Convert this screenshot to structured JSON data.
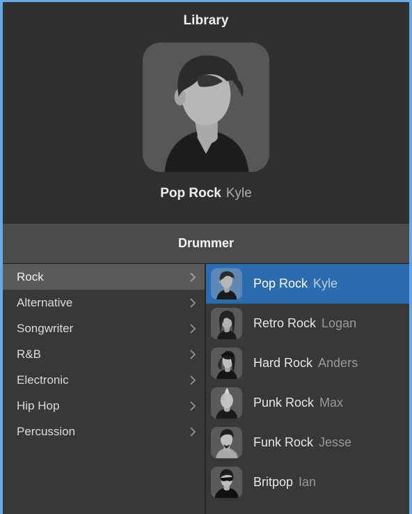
{
  "window": {
    "accent_border_color": "#68a7e8",
    "background_color": "#2e2e2e"
  },
  "library_header": {
    "title": "Library"
  },
  "preview": {
    "avatar_icon": "person-silhouette-avatar",
    "patch_name": "Pop Rock",
    "artist_name": "Kyle"
  },
  "drummer_header": {
    "title": "Drummer"
  },
  "categories": {
    "selected_index": 0,
    "chevron_icon": "chevron-right-icon",
    "items": [
      {
        "label": "Rock"
      },
      {
        "label": "Alternative"
      },
      {
        "label": "Songwriter"
      },
      {
        "label": "R&B"
      },
      {
        "label": "Electronic"
      },
      {
        "label": "Hip Hop"
      },
      {
        "label": "Percussion"
      }
    ]
  },
  "patches": {
    "selected_index": 0,
    "selection_color": "#2b6cae",
    "items": [
      {
        "name": "Pop Rock",
        "artist": "Kyle",
        "avatar_icon": "avatar-pop-rock-kyle"
      },
      {
        "name": "Retro Rock",
        "artist": "Logan",
        "avatar_icon": "avatar-retro-rock-logan"
      },
      {
        "name": "Hard Rock",
        "artist": "Anders",
        "avatar_icon": "avatar-hard-rock-anders"
      },
      {
        "name": "Punk Rock",
        "artist": "Max",
        "avatar_icon": "avatar-punk-rock-max"
      },
      {
        "name": "Funk Rock",
        "artist": "Jesse",
        "avatar_icon": "avatar-funk-rock-jesse"
      },
      {
        "name": "Britpop",
        "artist": "Ian",
        "avatar_icon": "avatar-britpop-ian"
      }
    ]
  }
}
